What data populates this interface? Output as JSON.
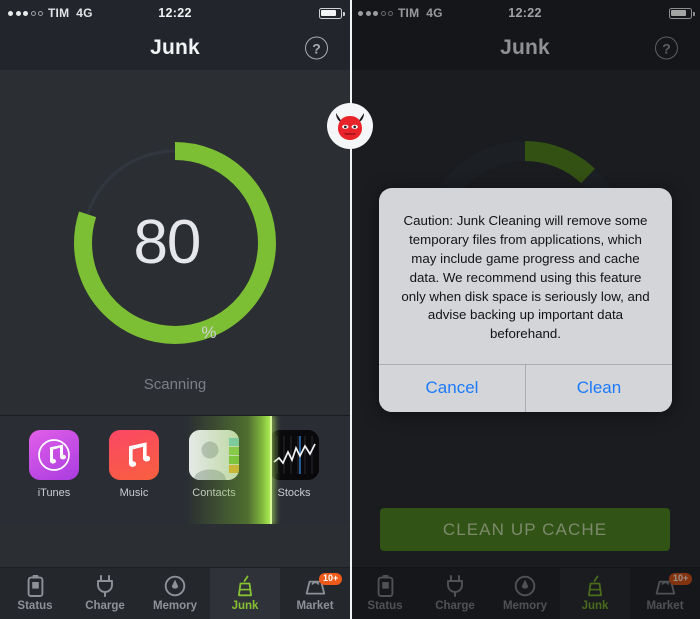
{
  "app": {
    "screens": [
      {
        "id": "scanning",
        "statusbar": {
          "carrier": "TIM",
          "network": "4G",
          "time": "12:22",
          "signal_dots_filled": 3,
          "signal_dots_empty": 2,
          "battery_level_pct": 78
        },
        "navbar": {
          "title": "Junk",
          "help_icon": "question-circle-icon"
        },
        "gauge": {
          "value": "80",
          "unit": "%",
          "percent": 80,
          "arc_color": "#7dbf34",
          "track_color": "#323640"
        },
        "status_text": "Scanning",
        "apps": [
          {
            "name": "iTunes",
            "icon": "itunes-app-icon"
          },
          {
            "name": "Music",
            "icon": "music-app-icon"
          },
          {
            "name": "Contacts",
            "icon": "contacts-app-icon"
          },
          {
            "name": "Stocks",
            "icon": "stocks-app-icon"
          }
        ],
        "tabs": [
          {
            "label": "Status",
            "icon": "battery-icon",
            "active": false,
            "badge": ""
          },
          {
            "label": "Charge",
            "icon": "plug-icon",
            "active": false,
            "badge": ""
          },
          {
            "label": "Memory",
            "icon": "speedometer-icon",
            "active": false,
            "badge": ""
          },
          {
            "label": "Junk",
            "icon": "broom-icon",
            "active": true,
            "badge": ""
          },
          {
            "label": "Market",
            "icon": "market-icon",
            "active": false,
            "badge": "10+"
          }
        ]
      },
      {
        "id": "confirm",
        "statusbar": {
          "carrier": "TIM",
          "network": "4G",
          "time": "12:22",
          "signal_dots_filled": 3,
          "signal_dots_empty": 2,
          "battery_level_pct": 78
        },
        "navbar": {
          "title": "Junk",
          "help_icon": "question-circle-icon"
        },
        "gauge": {
          "percent": 12,
          "arc_color": "#4e7a1f",
          "track_color": "#2a2d34"
        },
        "dialog": {
          "message": "Caution: Junk Cleaning will remove some temporary files from applications, which may include game progress and cache data.\nWe recommend using this feature only when disk space is seriously low, and advise backing up important data beforehand.",
          "cancel_label": "Cancel",
          "confirm_label": "Clean"
        },
        "cleanup_button": {
          "label": "CLEAN UP CACHE",
          "color": "#4a7c20"
        },
        "tabs": [
          {
            "label": "Status",
            "icon": "battery-icon",
            "active": false,
            "badge": ""
          },
          {
            "label": "Charge",
            "icon": "plug-icon",
            "active": false,
            "badge": ""
          },
          {
            "label": "Memory",
            "icon": "speedometer-icon",
            "active": false,
            "badge": ""
          },
          {
            "label": "Junk",
            "icon": "broom-icon",
            "active": true,
            "badge": ""
          },
          {
            "label": "Market",
            "icon": "market-icon",
            "active": false,
            "badge": "10+"
          }
        ]
      }
    ],
    "divider_logo": {
      "icon": "devil-head-logo",
      "color": "#e8232a"
    }
  }
}
